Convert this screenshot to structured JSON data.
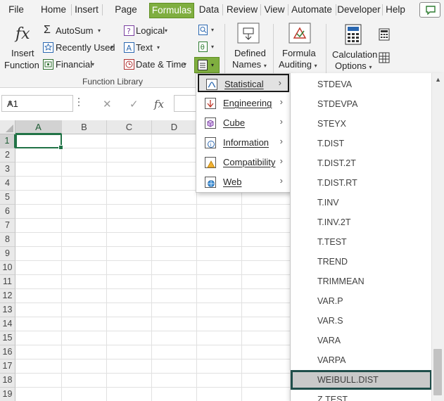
{
  "menu_tabs": [
    "File",
    "Home",
    "Insert",
    "Page Layc",
    "Formulas",
    "Data",
    "Review",
    "View",
    "Automate",
    "Developer",
    "Help"
  ],
  "active_tab": "Formulas",
  "ribbon": {
    "insert_function": [
      "Insert",
      "Function"
    ],
    "autosum": "AutoSum",
    "recently_used": "Recently Used",
    "financial": "Financial",
    "logical": "Logical",
    "text": "Text",
    "date_time": "Date & Time",
    "defined_names": [
      "Defined",
      "Names"
    ],
    "formula_auditing": [
      "Formula",
      "Auditing"
    ],
    "calculation_options": [
      "Calculation",
      "Options"
    ],
    "group_label": "Function Library",
    "fx_symbol": "fx"
  },
  "formula_bar": {
    "name_box": "A1",
    "cancel": "✕",
    "enter": "✓",
    "fx": "fx"
  },
  "grid": {
    "columns": [
      "A",
      "B",
      "C",
      "D"
    ],
    "rows": [
      "1",
      "2",
      "3",
      "4",
      "5",
      "6",
      "7",
      "8",
      "9",
      "10",
      "11",
      "12",
      "13",
      "14",
      "15",
      "16",
      "17",
      "18",
      "19"
    ]
  },
  "more_functions_menu": [
    {
      "label": "Statistical",
      "icon": "statistical-icon"
    },
    {
      "label": "Engineering",
      "icon": "engineering-icon"
    },
    {
      "label": "Cube",
      "icon": "cube-icon"
    },
    {
      "label": "Information",
      "icon": "information-icon"
    },
    {
      "label": "Compatibility",
      "icon": "compatibility-icon"
    },
    {
      "label": "Web",
      "icon": "web-icon"
    }
  ],
  "statistical_functions": [
    "STDEVA",
    "STDEVPA",
    "STEYX",
    "T.DIST",
    "T.DIST.2T",
    "T.DIST.RT",
    "T.INV",
    "T.INV.2T",
    "T.TEST",
    "TREND",
    "TRIMMEAN",
    "VAR.P",
    "VAR.S",
    "VARA",
    "VARPA",
    "WEIBULL.DIST",
    "Z.TEST"
  ],
  "highlighted_function": "WEIBULL.DIST",
  "colors": {
    "accent_green": "#217346",
    "formulas_tab": "#7fae3f"
  }
}
